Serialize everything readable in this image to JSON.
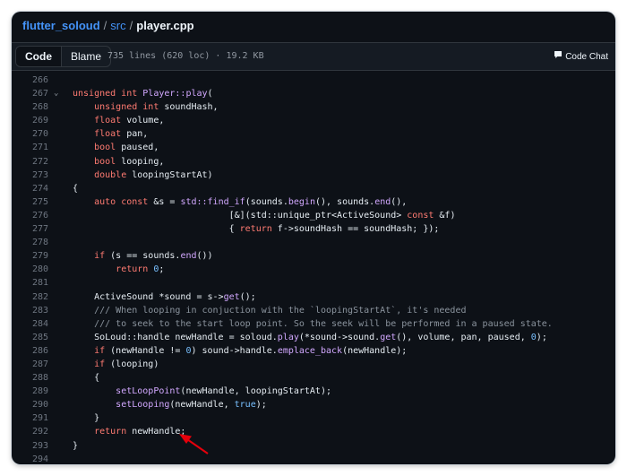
{
  "breadcrumb": {
    "repo": "flutter_soloud",
    "sep1": "/",
    "dir": "src",
    "sep2": "/",
    "file": "player.cpp"
  },
  "toolbar": {
    "code_label": "Code",
    "blame_label": "Blame",
    "file_info": "735 lines (620 loc) · 19.2 KB",
    "chat_label": "Code Chat"
  },
  "colors": {
    "keyword": "#ff7b72",
    "function": "#d2a8ff",
    "comment": "#8b949e",
    "number": "#79c0ff",
    "text": "#e6edf3",
    "annotation_arrow": "#e5000b"
  },
  "icons": {
    "chat": "comment-icon",
    "fold": "chevron-down-icon"
  },
  "code_lines": [
    {
      "n": "266",
      "tokens": []
    },
    {
      "n": "267",
      "fold": "⌄",
      "tokens": [
        [
          "kw",
          "unsigned int "
        ],
        [
          "fn",
          "Player::play"
        ],
        [
          "t",
          "("
        ]
      ]
    },
    {
      "n": "268",
      "tokens": [
        [
          "t",
          "    "
        ],
        [
          "kw",
          "unsigned int "
        ],
        [
          "t",
          "soundHash,"
        ]
      ]
    },
    {
      "n": "269",
      "tokens": [
        [
          "t",
          "    "
        ],
        [
          "kw",
          "float "
        ],
        [
          "t",
          "volume,"
        ]
      ]
    },
    {
      "n": "270",
      "tokens": [
        [
          "t",
          "    "
        ],
        [
          "kw",
          "float "
        ],
        [
          "t",
          "pan,"
        ]
      ]
    },
    {
      "n": "271",
      "tokens": [
        [
          "t",
          "    "
        ],
        [
          "kw",
          "bool "
        ],
        [
          "t",
          "paused,"
        ]
      ]
    },
    {
      "n": "272",
      "tokens": [
        [
          "t",
          "    "
        ],
        [
          "kw",
          "bool "
        ],
        [
          "t",
          "looping,"
        ]
      ]
    },
    {
      "n": "273",
      "tokens": [
        [
          "t",
          "    "
        ],
        [
          "kw",
          "double "
        ],
        [
          "t",
          "loopingStartAt)"
        ]
      ]
    },
    {
      "n": "274",
      "tokens": [
        [
          "t",
          "{"
        ]
      ]
    },
    {
      "n": "275",
      "tokens": [
        [
          "t",
          "    "
        ],
        [
          "kw",
          "auto const "
        ],
        [
          "t",
          "&s = "
        ],
        [
          "fn",
          "std::find_if"
        ],
        [
          "t",
          "(sounds."
        ],
        [
          "fn",
          "begin"
        ],
        [
          "t",
          "(), sounds."
        ],
        [
          "fn",
          "end"
        ],
        [
          "t",
          "(),"
        ]
      ]
    },
    {
      "n": "276",
      "tokens": [
        [
          "t",
          "                             [&](std::unique_ptr<ActiveSound> "
        ],
        [
          "kw",
          "const "
        ],
        [
          "t",
          "&f)"
        ]
      ]
    },
    {
      "n": "277",
      "tokens": [
        [
          "t",
          "                             { "
        ],
        [
          "kw",
          "return "
        ],
        [
          "t",
          "f->soundHash == soundHash; });"
        ]
      ]
    },
    {
      "n": "278",
      "tokens": []
    },
    {
      "n": "279",
      "tokens": [
        [
          "t",
          "    "
        ],
        [
          "kw",
          "if "
        ],
        [
          "t",
          "(s == sounds."
        ],
        [
          "fn",
          "end"
        ],
        [
          "t",
          "())"
        ]
      ]
    },
    {
      "n": "280",
      "tokens": [
        [
          "t",
          "        "
        ],
        [
          "kw",
          "return "
        ],
        [
          "num",
          "0"
        ],
        [
          "t",
          ";"
        ]
      ]
    },
    {
      "n": "281",
      "tokens": []
    },
    {
      "n": "282",
      "tokens": [
        [
          "t",
          "    ActiveSound *sound = s->"
        ],
        [
          "fn",
          "get"
        ],
        [
          "t",
          "();"
        ]
      ]
    },
    {
      "n": "283",
      "tokens": [
        [
          "cm",
          "    /// When looping in conjuction with the `loopingStartAt`, it's needed"
        ]
      ]
    },
    {
      "n": "284",
      "tokens": [
        [
          "cm",
          "    /// to seek to the start loop point. So the seek will be performed in a paused state."
        ]
      ]
    },
    {
      "n": "285",
      "tokens": [
        [
          "t",
          "    SoLoud::handle newHandle = soloud."
        ],
        [
          "fn",
          "play"
        ],
        [
          "t",
          "(*sound->sound."
        ],
        [
          "fn",
          "get"
        ],
        [
          "t",
          "(), volume, pan, paused, "
        ],
        [
          "num",
          "0"
        ],
        [
          "t",
          ");"
        ]
      ]
    },
    {
      "n": "286",
      "tokens": [
        [
          "t",
          "    "
        ],
        [
          "kw",
          "if "
        ],
        [
          "t",
          "(newHandle != "
        ],
        [
          "num",
          "0"
        ],
        [
          "t",
          ") sound->handle."
        ],
        [
          "fn",
          "emplace_back"
        ],
        [
          "t",
          "(newHandle);"
        ]
      ]
    },
    {
      "n": "287",
      "tokens": [
        [
          "t",
          "    "
        ],
        [
          "kw",
          "if "
        ],
        [
          "t",
          "(looping)"
        ]
      ]
    },
    {
      "n": "288",
      "tokens": [
        [
          "t",
          "    {"
        ]
      ]
    },
    {
      "n": "289",
      "tokens": [
        [
          "t",
          "        "
        ],
        [
          "fn",
          "setLoopPoint"
        ],
        [
          "t",
          "(newHandle, loopingStartAt);"
        ]
      ]
    },
    {
      "n": "290",
      "tokens": [
        [
          "t",
          "        "
        ],
        [
          "fn",
          "setLooping"
        ],
        [
          "t",
          "(newHandle, "
        ],
        [
          "num",
          "true"
        ],
        [
          "t",
          ");"
        ]
      ]
    },
    {
      "n": "291",
      "tokens": [
        [
          "t",
          "    }"
        ]
      ]
    },
    {
      "n": "292",
      "tokens": [
        [
          "t",
          "    "
        ],
        [
          "kw",
          "return "
        ],
        [
          "t",
          "newHandle;"
        ]
      ]
    },
    {
      "n": "293",
      "tokens": [
        [
          "t",
          "}"
        ]
      ]
    },
    {
      "n": "294",
      "tokens": []
    }
  ]
}
